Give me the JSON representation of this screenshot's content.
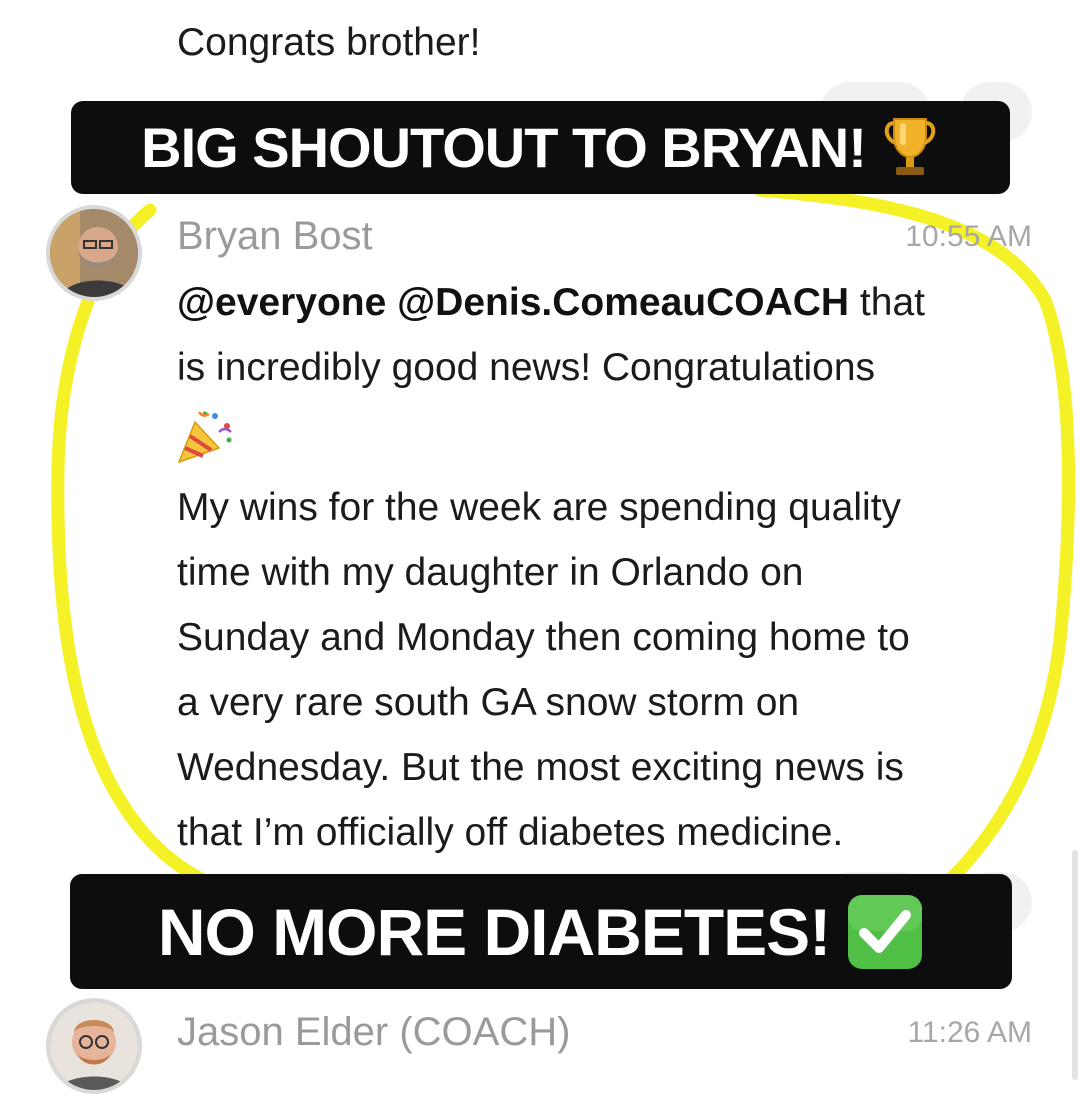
{
  "previous_message": {
    "text": "Congrats brother!"
  },
  "banners": {
    "top": {
      "text": "BIG SHOUTOUT TO BRYAN!",
      "emoji_name": "trophy-icon"
    },
    "bottom": {
      "text": "NO MORE DIABETES!",
      "emoji_name": "check-mark-icon"
    }
  },
  "highlight_color": "#f4f01b",
  "messages": [
    {
      "author": "Bryan Bost",
      "time": "10:55 AM",
      "mention_1": "@everyone",
      "mention_2": "@Denis.ComeauCOACH",
      "line_1_tail": " that",
      "line_2": "is incredibly good news!  Congratulations",
      "emoji_name": "party-popper-icon",
      "paragraph_2": [
        "My wins for the week are spending quality",
        "time with my daughter in Orlando on",
        "Sunday and Monday then coming home to",
        "a very rare south GA snow storm on",
        "Wednesday. But the most exciting news is",
        "that I’m officially off diabetes medicine."
      ]
    },
    {
      "author": "Jason Elder (COACH)",
      "time": "11:26 AM"
    }
  ]
}
